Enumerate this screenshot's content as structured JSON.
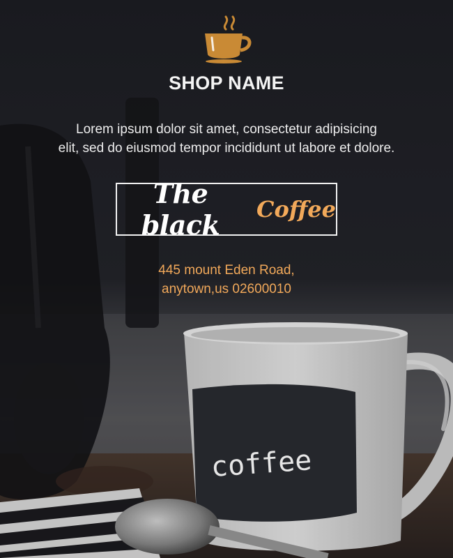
{
  "shop": {
    "name": "SHOP NAME",
    "logo_icon": "coffee-cup-icon"
  },
  "tagline": {
    "line1": "Lorem ipsum dolor sit amet, consectetur adipisicing",
    "line2": "elit, sed do eiusmod tempor incididunt ut labore et dolore."
  },
  "badge": {
    "part1": "The black",
    "part2": "Coffee"
  },
  "address": {
    "line1": "445 mount Eden Road,",
    "line2": "anytown,us 02600010"
  },
  "photo": {
    "mug_text": "coffee"
  },
  "colors": {
    "background": "#1d1e23",
    "accent": "#f2a95a",
    "logo": "#c98a35",
    "text": "#ffffff"
  }
}
